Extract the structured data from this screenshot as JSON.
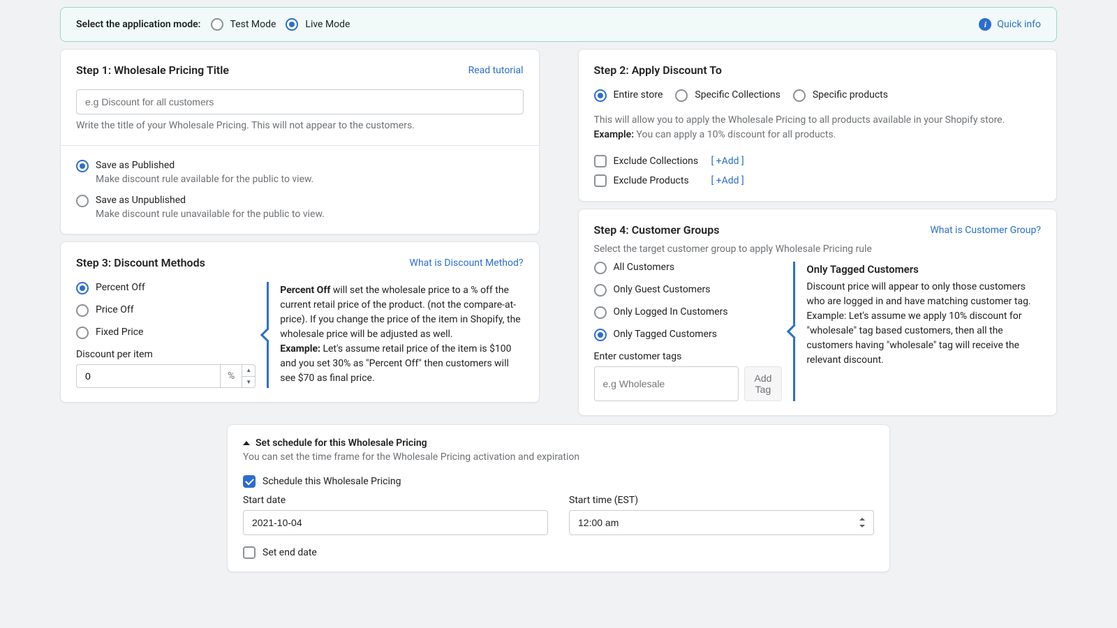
{
  "banner": {
    "label": "Select the application mode:",
    "test_mode": "Test Mode",
    "live_mode": "Live Mode",
    "quick_info": "Quick info"
  },
  "step1": {
    "title": "Step 1: Wholesale Pricing Title",
    "read_tutorial": "Read tutorial",
    "placeholder": "e.g Discount for all customers",
    "help": "Write the title of your Wholesale Pricing. This will not appear to the customers.",
    "published_title": "Save as Published",
    "published_desc": "Make discount rule available for the public to view.",
    "unpublished_title": "Save as Unpublished",
    "unpublished_desc": "Make discount rule unavailable for the public to view."
  },
  "step2": {
    "title": "Step 2: Apply Discount To",
    "opt_entire": "Entire store",
    "opt_collections": "Specific Collections",
    "opt_products": "Specific products",
    "desc": "This will allow you to apply the Wholesale Pricing to all products available in your Shopify store.",
    "example_label": "Example:",
    "example_text": " You can apply a 10% discount for all products.",
    "exclude_collections": "Exclude Collections",
    "exclude_products": "Exclude Products",
    "add_link": "[ +Add ]"
  },
  "step3": {
    "title": "Step 3: Discount Methods",
    "what_link": "What is Discount Method?",
    "opt_percent": "Percent Off",
    "opt_price": "Price Off",
    "opt_fixed": "Fixed Price",
    "discount_per_item": "Discount per item",
    "discount_value": "0",
    "unit": "%",
    "side_bold1": "Percent Off",
    "side_text1": " will set the wholesale price to a % off the current retail price of the product. (not the compare-at-price). If you change the price of the item in Shopify, the wholesale price will be adjusted as well.",
    "side_example_label": "Example:",
    "side_example_text": " Let's assume retail price of the item is $100 and you set 30% as \"Percent Off\" then customers will see $70 as final price."
  },
  "step4": {
    "title": "Step 4: Customer Groups",
    "what_link": "What is Customer Group?",
    "subtitle": "Select the target customer group to apply Wholesale Pricing rule",
    "opt_all": "All Customers",
    "opt_guest": "Only Guest Customers",
    "opt_logged": "Only Logged In Customers",
    "opt_tagged": "Only Tagged Customers",
    "tags_label": "Enter customer tags",
    "tags_placeholder": "e.g Wholesale",
    "add_tag_btn": "Add Tag",
    "side_title": "Only Tagged Customers",
    "side_text": "Discount price will appear to only those customers who are logged in and have matching customer tag. Example: Let's assume we apply 10% discount for \"wholesale\" tag based customers, then all the customers having \"wholesale\" tag will receive the relevant discount."
  },
  "schedule": {
    "head": "Set schedule for this Wholesale Pricing",
    "sub": "You can set the time frame for the Wholesale Pricing activation and expiration",
    "schedule_this": "Schedule this Wholesale Pricing",
    "start_date_label": "Start date",
    "start_date_value": "2021-10-04",
    "start_time_label": "Start time (EST)",
    "start_time_value": "12:00 am",
    "set_end_date": "Set end date"
  }
}
